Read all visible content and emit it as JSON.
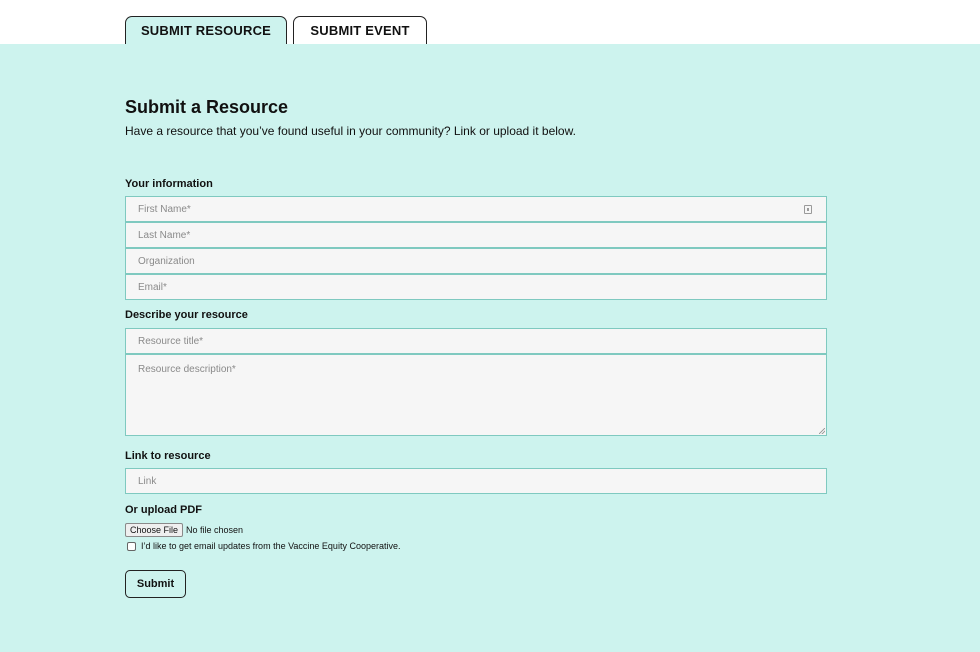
{
  "tabs": [
    {
      "label": "SUBMIT RESOURCE",
      "active": true
    },
    {
      "label": "SUBMIT EVENT",
      "active": false
    }
  ],
  "form": {
    "title": "Submit a Resource",
    "subtitle": "Have a resource that you’ve found useful in your community? Link or upload it below.",
    "sections": {
      "your_information": "Your information",
      "describe": "Describe your resource",
      "link": "Link to resource",
      "upload": "Or upload PDF"
    },
    "fields": {
      "first_name": {
        "placeholder": "First Name*",
        "value": ""
      },
      "last_name": {
        "placeholder": "Last Name*",
        "value": ""
      },
      "organization": {
        "placeholder": "Organization",
        "value": ""
      },
      "email": {
        "placeholder": "Email*",
        "value": ""
      },
      "resource_title": {
        "placeholder": "Resource title*",
        "value": ""
      },
      "resource_description": {
        "placeholder": "Resource description*",
        "value": ""
      },
      "link": {
        "placeholder": "Link",
        "value": ""
      }
    },
    "file": {
      "button_label": "Choose File",
      "status": "No file chosen"
    },
    "updates_checkbox": {
      "label": "I’d like to get email updates from the Vaccine Equity Cooperative.",
      "checked": false
    },
    "submit_label": "Submit"
  },
  "colors": {
    "panel_background": "#cdf3ee",
    "field_border": "#7fc9c0",
    "field_background": "#f6f6f6",
    "text": "#111111",
    "placeholder": "#8a8a8a"
  },
  "icons": {
    "autofill": "contact-card-icon",
    "resize": "resize-grip-icon"
  }
}
